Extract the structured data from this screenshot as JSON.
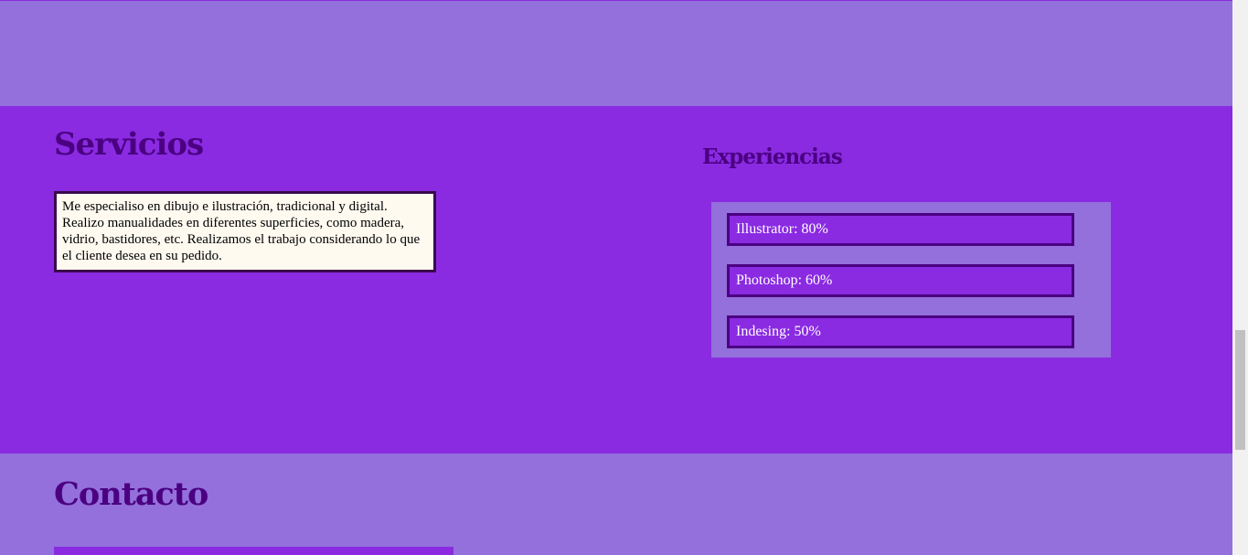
{
  "servicios": {
    "title": "Servicios",
    "description": "Me especialiso en dibujo e ilustración, tradicional y digital. Realizo manualidades en diferentes superficies, como madera, vidrio, bastidores, etc. Realizamos el trabajo considerando lo que el cliente desea en su pedido."
  },
  "experiencias": {
    "title": "Experiencias",
    "items": [
      {
        "label": "Illustrator: 80%"
      },
      {
        "label": "Photoshop: 60%"
      },
      {
        "label": "Indesing: 50%"
      }
    ]
  },
  "contacto": {
    "title": "Contacto"
  },
  "colors": {
    "light_purple": "#9370db",
    "violet": "#8a2be2",
    "indigo": "#4b0082",
    "box_bg": "#fffaf0"
  }
}
